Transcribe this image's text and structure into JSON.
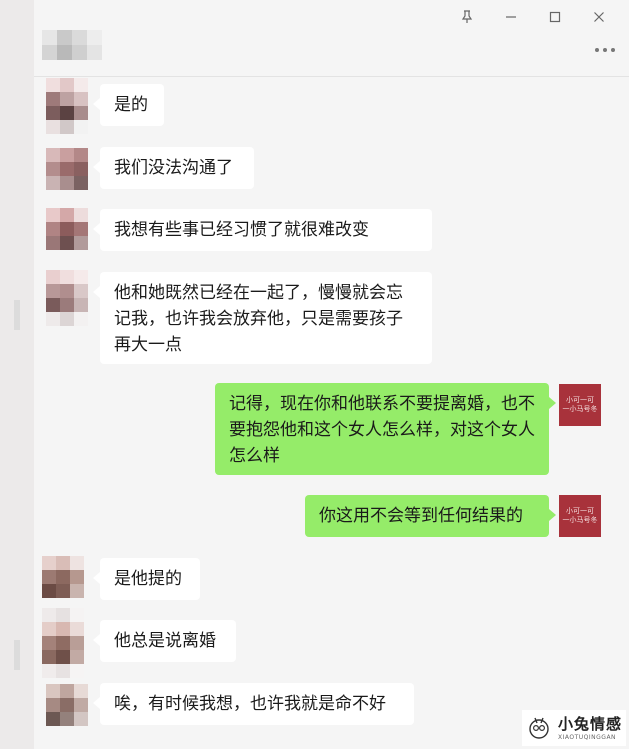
{
  "window": {
    "buttons": [
      {
        "name": "pin",
        "glyph": "⚓"
      },
      {
        "name": "minimize",
        "glyph": "—"
      },
      {
        "name": "maximize",
        "glyph": "□"
      },
      {
        "name": "close",
        "glyph": "✕"
      }
    ],
    "more_icon": "more-horizontal-icon"
  },
  "messages": [
    {
      "direction": "in",
      "text": "是的"
    },
    {
      "direction": "in",
      "text": "我们没法沟通了"
    },
    {
      "direction": "in",
      "text": "我想有些事已经习惯了就很难改变"
    },
    {
      "direction": "in",
      "text": "他和她既然已经在一起了，慢慢就会忘记我，也许我会放弃他，只是需要孩子再大一点"
    },
    {
      "direction": "out",
      "text": "记得，现在你和他联系不要提离婚，也不要抱怨他和这个女人怎么样，对这个女人怎么样"
    },
    {
      "direction": "out",
      "text": "你这用不会等到任何结果的"
    },
    {
      "direction": "in",
      "text": "是他提的"
    },
    {
      "direction": "in",
      "text": "他总是说离婚"
    },
    {
      "direction": "in",
      "text": "唉，有时候我想，也许我就是命不好"
    }
  ],
  "my_avatar_text": "小可一可\n一小马号冬",
  "watermark": {
    "title": "小兔情感",
    "subtitle": "XIAOTUQINGGAN"
  },
  "colors": {
    "background": "#f5f5f5",
    "incoming_bubble": "#ffffff",
    "outgoing_bubble": "#95ec69",
    "my_avatar": "#a8323b"
  }
}
